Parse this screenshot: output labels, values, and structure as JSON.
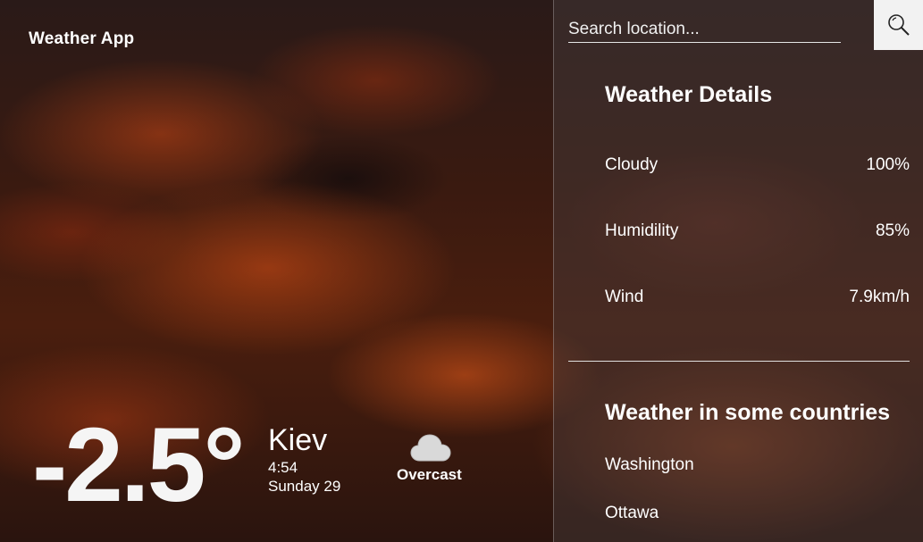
{
  "app": {
    "title": "Weather App"
  },
  "current": {
    "temperature": "-2.5°",
    "city": "Kiev",
    "time": "4:54",
    "date": "Sunday 29",
    "condition": "Overcast",
    "condition_icon": "cloud-icon"
  },
  "search": {
    "placeholder": "Search location...",
    "icon": "search-icon"
  },
  "details": {
    "title": "Weather Details",
    "rows": [
      {
        "label": "Cloudy",
        "value": "100%"
      },
      {
        "label": "Humidility",
        "value": "85%"
      },
      {
        "label": "Wind",
        "value": "7.9km/h"
      }
    ]
  },
  "countries": {
    "title": "Weather in some countries",
    "items": [
      "Washington",
      "Ottawa"
    ]
  }
}
